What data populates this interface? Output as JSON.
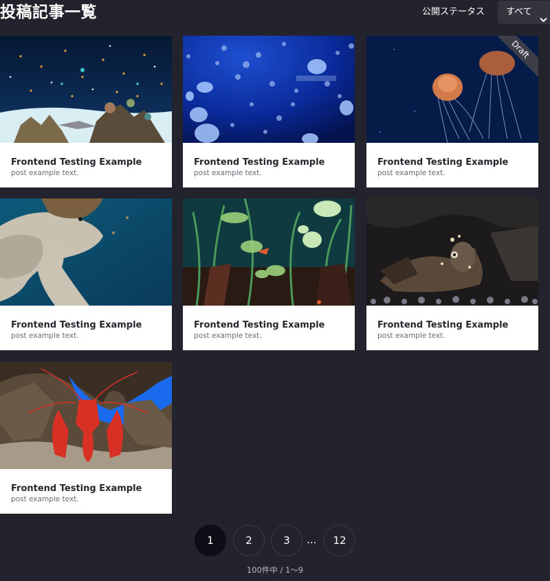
{
  "header": {
    "title": "投稿記事一覧",
    "status_label": "公開ステータス",
    "status_select": {
      "value": "すべて",
      "chevron": "⌄"
    }
  },
  "posts": [
    {
      "title": "Frontend Testing Example",
      "excerpt": "post example text.",
      "image": "aquarium-reef-fish",
      "draft": false
    },
    {
      "title": "Frontend Testing Example",
      "excerpt": "post example text.",
      "image": "moon-jellyfish",
      "draft": false
    },
    {
      "title": "Frontend Testing Example",
      "excerpt": "post example text.",
      "image": "orange-jellyfish",
      "draft": true,
      "badge": "Draft"
    },
    {
      "title": "Frontend Testing Example",
      "excerpt": "post example text.",
      "image": "sea-turtle",
      "draft": false
    },
    {
      "title": "Frontend Testing Example",
      "excerpt": "post example text.",
      "image": "aquatic-plants",
      "draft": false
    },
    {
      "title": "Frontend Testing Example",
      "excerpt": "post example text.",
      "image": "scorpionfish",
      "draft": false
    },
    {
      "title": "Frontend Testing Example",
      "excerpt": "post example text.",
      "image": "red-lobster",
      "draft": false
    }
  ],
  "pagination": {
    "pages": [
      "1",
      "2",
      "3",
      "12"
    ],
    "current": "1",
    "ellipsis": "...",
    "summary": "100件中 / 1〜9"
  }
}
